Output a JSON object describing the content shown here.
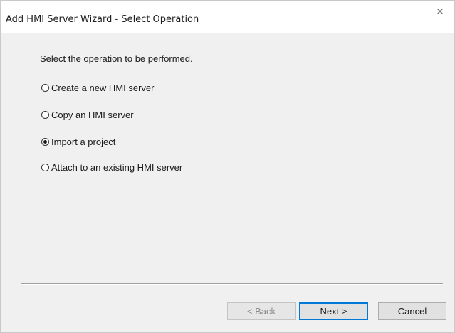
{
  "window": {
    "title": "Add HMI Server Wizard - Select Operation",
    "close_glyph": "✕"
  },
  "main": {
    "instruction": "Select the operation to be performed.",
    "options": [
      {
        "label": "Create a new HMI server",
        "selected": false
      },
      {
        "label": "Copy an HMI server",
        "selected": false
      },
      {
        "label": "Import a project",
        "selected": true
      },
      {
        "label": "Attach to an existing HMI server",
        "selected": false
      }
    ]
  },
  "footer": {
    "back_label": "< Back",
    "back_enabled": false,
    "next_label": "Next >",
    "cancel_label": "Cancel"
  },
  "colors": {
    "content_bg": "#f0f0f0",
    "default_button_border": "#0078d7"
  }
}
